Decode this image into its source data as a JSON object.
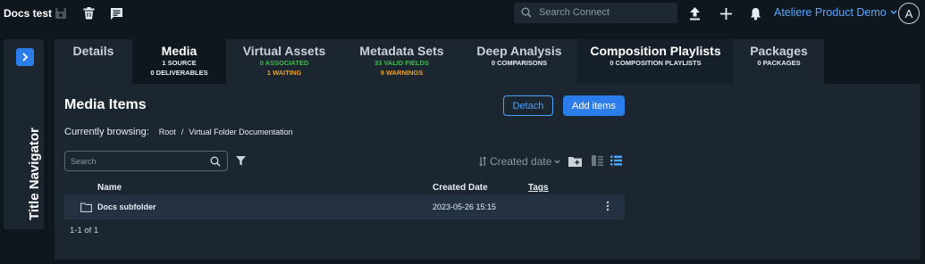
{
  "header": {
    "app_title": "Docs test",
    "search_placeholder": "Search Connect",
    "user_name": "Ateliere Product Demo",
    "avatar_letter": "A"
  },
  "navigator": {
    "label": "Title Navigator"
  },
  "tabs": [
    {
      "label": "Details",
      "subs": []
    },
    {
      "label": "Media",
      "subs": [
        {
          "text": "1 SOURCE",
          "tone": "white"
        },
        {
          "text": "0 DELIVERABLES",
          "tone": "white"
        }
      ],
      "active": true
    },
    {
      "label": "Virtual Assets",
      "subs": [
        {
          "text": "0 ASSOCIATED",
          "tone": "green"
        },
        {
          "text": "1 WAITING",
          "tone": "orange"
        }
      ]
    },
    {
      "label": "Metadata Sets",
      "subs": [
        {
          "text": "33 VALID FIELDS",
          "tone": "green"
        },
        {
          "text": "9 WARNINGS",
          "tone": "orange"
        }
      ]
    },
    {
      "label": "Deep Analysis",
      "subs": [
        {
          "text": "0 COMPARISONS",
          "tone": "white"
        }
      ]
    },
    {
      "label": "Composition Playlists",
      "subs": [
        {
          "text": "0 COMPOSITION PLAYLISTS",
          "tone": "white"
        }
      ]
    },
    {
      "label": "Packages",
      "subs": [
        {
          "text": "0 PACKAGES",
          "tone": "white"
        }
      ]
    }
  ],
  "media": {
    "title": "Media Items",
    "detach_label": "Detach",
    "add_label": "Add items",
    "browsing_label": "Currently browsing:",
    "breadcrumb": [
      "Root",
      "Virtual Folder Documentation"
    ],
    "search_placeholder": "Search",
    "sort_label": "Created date",
    "columns": {
      "name": "Name",
      "created": "Created Date",
      "tags": "Tags"
    },
    "rows": [
      {
        "name": "Docs subfolder",
        "created": "2023-05-26 15:15",
        "tags": ""
      }
    ],
    "pagination": "1-1 of 1"
  },
  "colors": {
    "accent": "#2b7de9",
    "link": "#58a6ff",
    "success": "#3fb950",
    "warning": "#f0a020",
    "background": "#0f171e",
    "panel": "#1c2631"
  },
  "icons": [
    "save-icon",
    "trash-icon",
    "comment-icon",
    "search-icon",
    "upload-icon",
    "plus-icon",
    "bell-icon",
    "chevron-down-icon",
    "chevron-right-icon",
    "filter-icon",
    "sort-icon",
    "new-folder-icon",
    "split-view-icon",
    "list-view-icon",
    "folder-icon",
    "more-vertical-icon"
  ]
}
